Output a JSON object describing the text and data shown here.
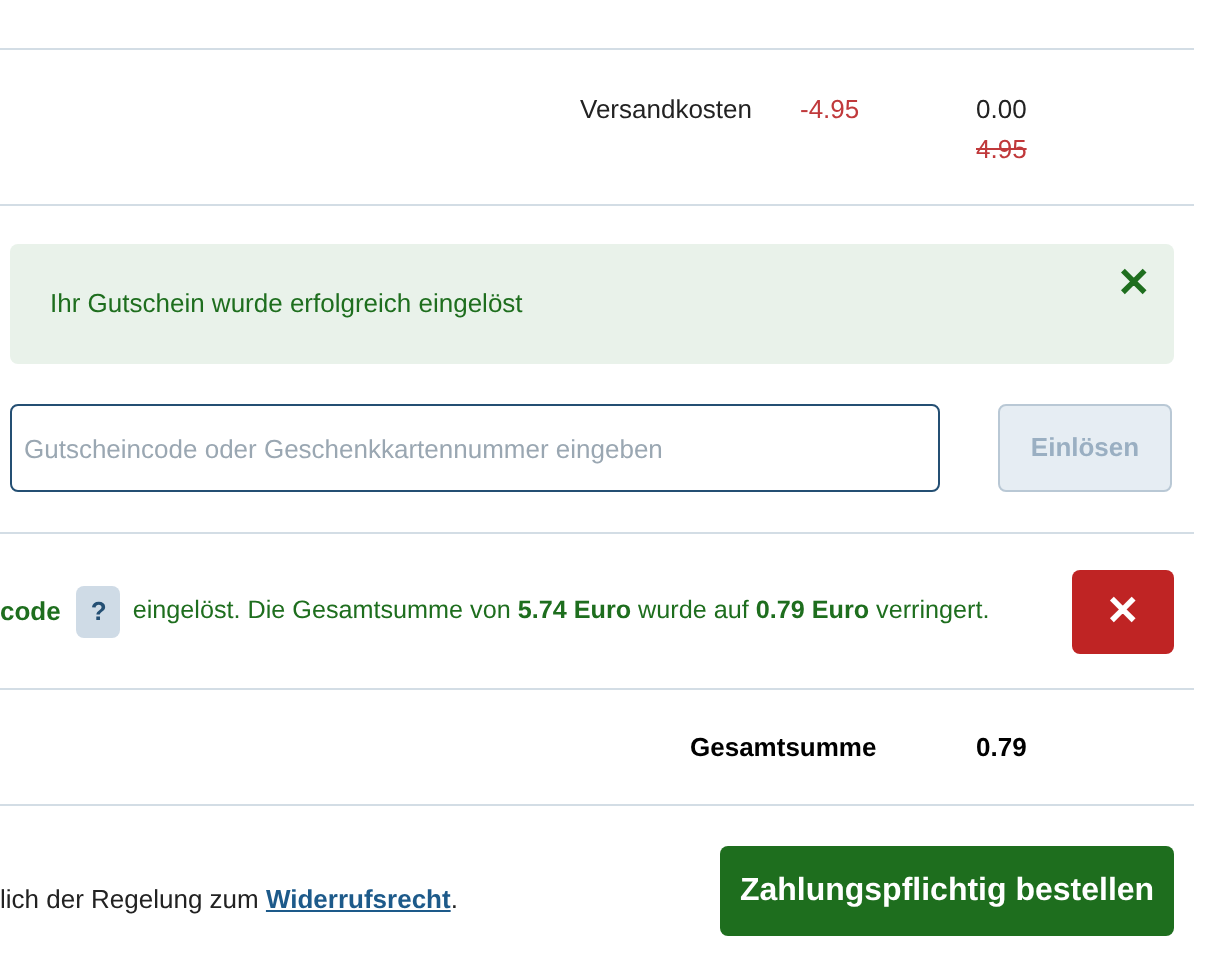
{
  "shipping": {
    "label": "Versandkosten",
    "discount": "-4.95",
    "price": "0.00",
    "old_price": "4.95"
  },
  "alert": {
    "message": "Ihr Gutschein wurde erfolgreich eingelöst",
    "close": "✕"
  },
  "voucher": {
    "placeholder": "Gutscheincode oder Geschenkkartennummer eingeben",
    "button": "Einlösen",
    "disabled": true
  },
  "redeemed": {
    "code": "code",
    "help": "?",
    "message": "eingelöst. Die Gesamtsumme von **5.74 Euro** wurde auf **0.79 Euro** verringert.",
    "remove": "✕"
  },
  "total": {
    "label": "Gesamtsumme",
    "value": "0.79"
  },
  "legal": {
    "before": "lich der Regelung zum ",
    "link": "Widerrufsrecht",
    "after": "."
  },
  "order_button": "Zahlungspflichtig bestellen"
}
